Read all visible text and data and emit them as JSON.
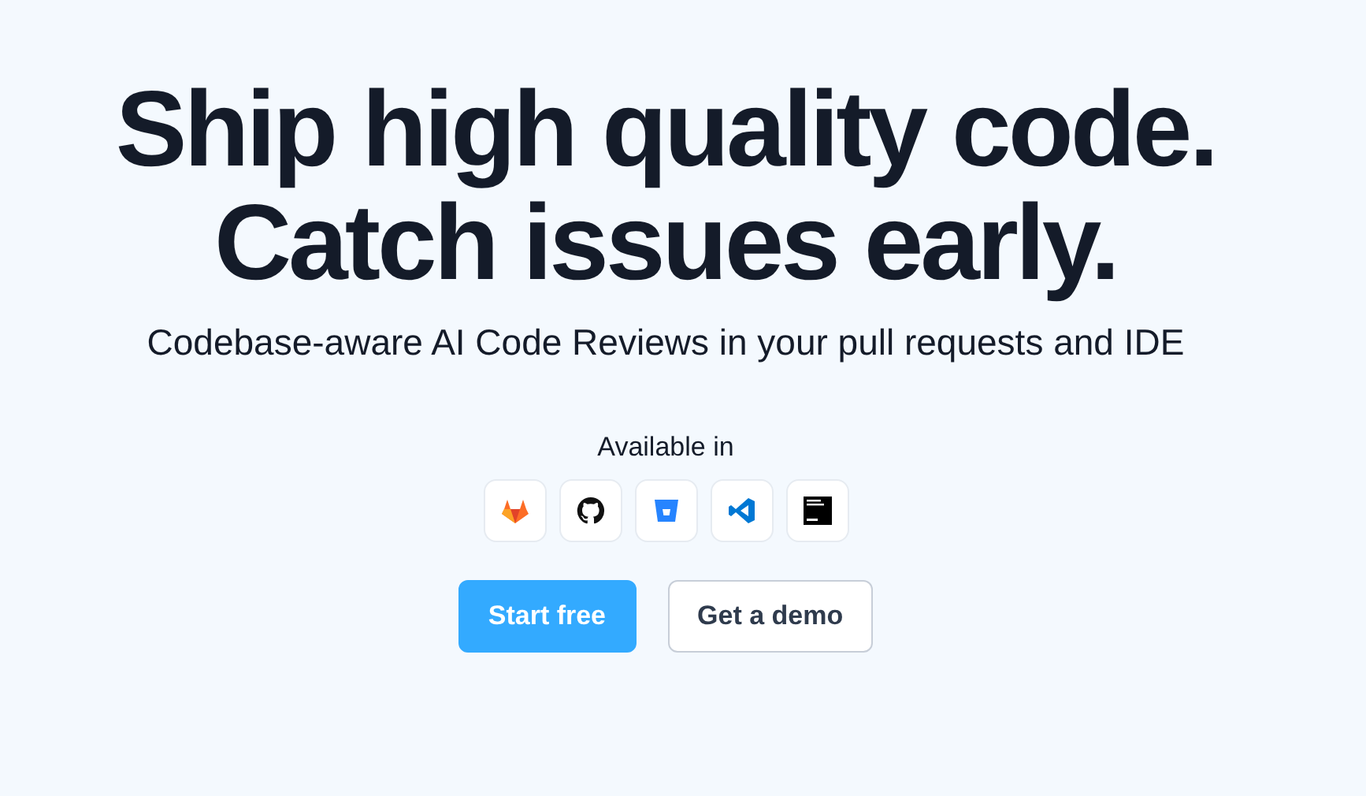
{
  "headline": [
    "Ship high quality code.",
    "Catch issues early."
  ],
  "subtitle": "Codebase-aware AI Code Reviews in your pull requests and IDE",
  "available_label": "Available in",
  "platforms": [
    {
      "kind": "fox"
    },
    {
      "kind": "cat"
    },
    {
      "kind": "bucket"
    },
    {
      "kind": "editor"
    },
    {
      "kind": "square"
    }
  ],
  "buttons": [
    {
      "label": "Start free",
      "kind": "primary"
    },
    {
      "label": "Get a demo",
      "kind": "secondary"
    }
  ]
}
